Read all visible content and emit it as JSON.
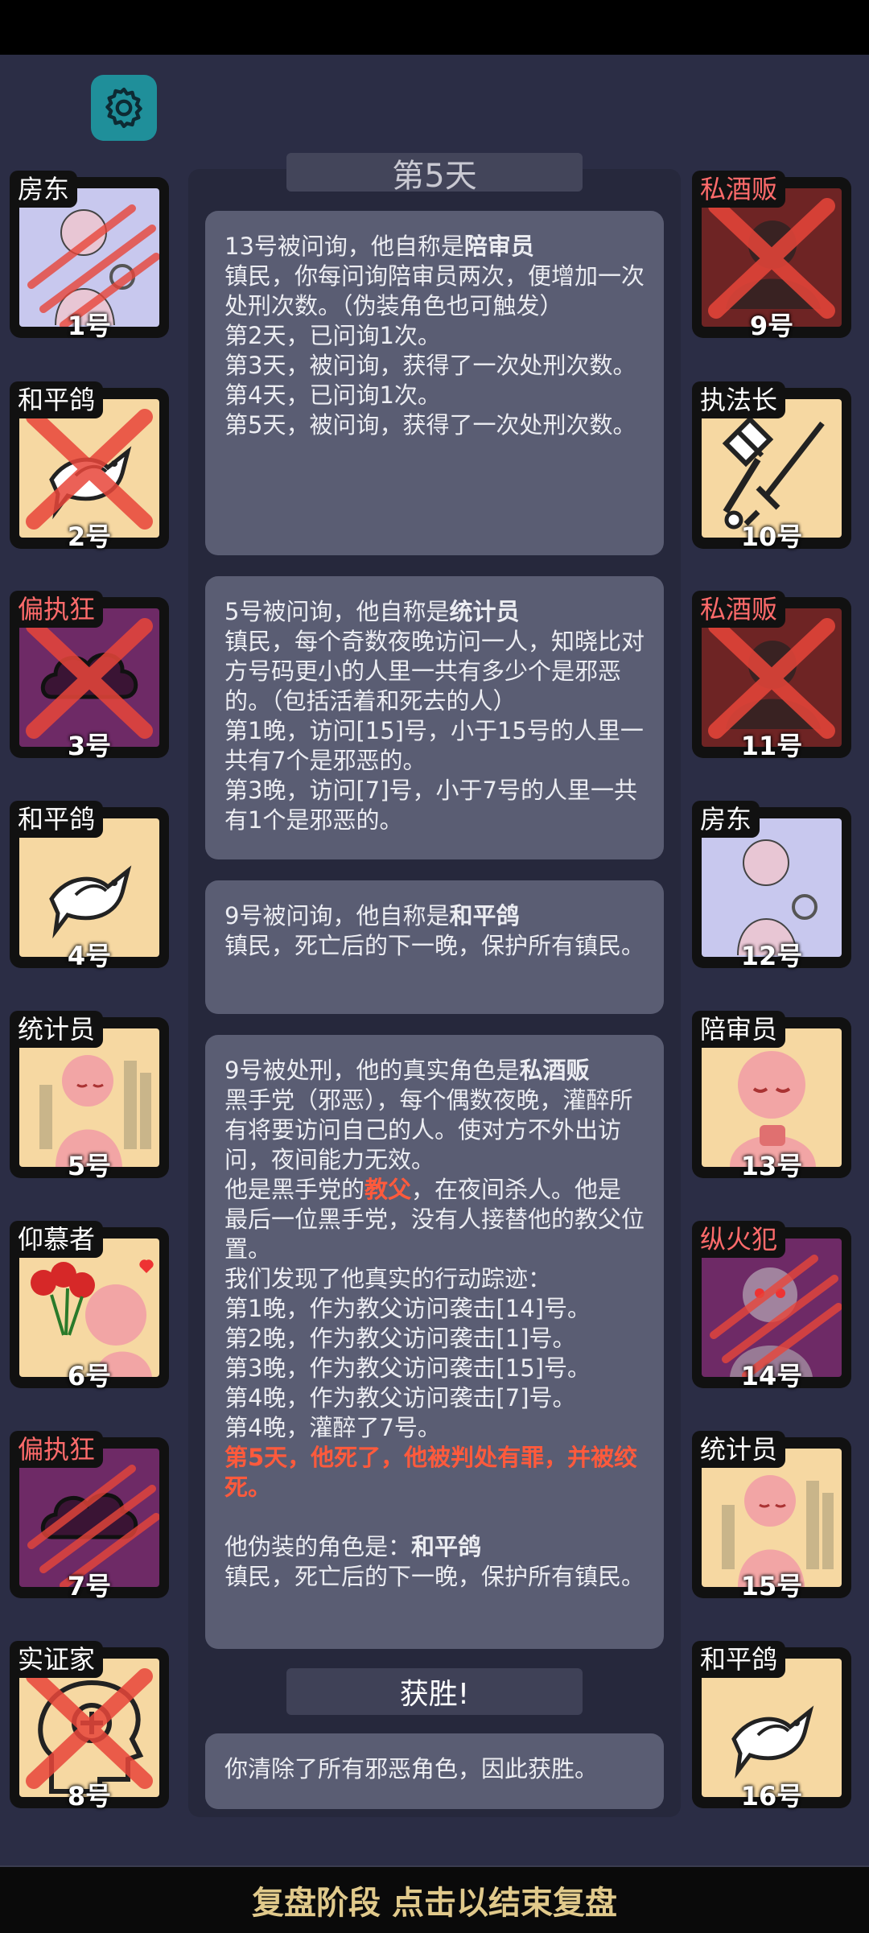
{
  "colors": {
    "bg": "#2b2d45",
    "evil_text": "#ff6b6b",
    "highlight": "#ff5a3c",
    "bottom_text": "#e0c98b"
  },
  "settings": {
    "icon": "gear-icon"
  },
  "day_header": "第5天",
  "messages": [
    {
      "lines": [
        {
          "parts": [
            {
              "t": "13号被问询，他自称是"
            },
            {
              "t": "陪审员",
              "b": true
            }
          ]
        },
        {
          "parts": [
            {
              "t": "镇民，你每问询陪审员两次，便增加一次处刑次数。（伪装角色也可触发）"
            }
          ]
        },
        {
          "parts": [
            {
              "t": "第2天，已问询1次。"
            }
          ]
        },
        {
          "parts": [
            {
              "t": "第3天，被问询，获得了一次处刑次数。"
            }
          ]
        },
        {
          "parts": [
            {
              "t": "第4天，已问询1次。"
            }
          ]
        },
        {
          "parts": [
            {
              "t": "第5天，被问询，获得了一次处刑次数。"
            }
          ]
        }
      ]
    },
    {
      "lines": [
        {
          "parts": [
            {
              "t": "5号被问询，他自称是"
            },
            {
              "t": "统计员",
              "b": true
            }
          ]
        },
        {
          "parts": [
            {
              "t": "镇民，每个奇数夜晚访问一人，知晓比对方号码更小的人里一共有多少个是邪恶的。（包括活着和死去的人）"
            }
          ]
        },
        {
          "parts": [
            {
              "t": "第1晚，访问[15]号，小于15号的人里一共有7个是邪恶的。"
            }
          ]
        },
        {
          "parts": [
            {
              "t": "第3晚，访问[7]号，小于7号的人里一共有1个是邪恶的。"
            }
          ]
        }
      ]
    },
    {
      "lines": [
        {
          "parts": [
            {
              "t": "9号被问询，他自称是"
            },
            {
              "t": "和平鸽",
              "b": true
            }
          ]
        },
        {
          "parts": [
            {
              "t": "镇民，死亡后的下一晚，保护所有镇民。"
            }
          ]
        }
      ]
    },
    {
      "lines": [
        {
          "parts": [
            {
              "t": "9号被处刑，他的真实角色是"
            },
            {
              "t": "私酒贩",
              "b": true
            }
          ]
        },
        {
          "parts": [
            {
              "t": "黑手党（邪恶），每个偶数夜晚，灌醉所有将要访问自己的人。使对方不外出访问，夜间能力无效。"
            }
          ]
        },
        {
          "parts": [
            {
              "t": "他是黑手党的"
            },
            {
              "t": "教父",
              "r": true
            },
            {
              "t": "，在夜间杀人。他是最后一位黑手党，没有人接替他的教父位置。"
            }
          ]
        },
        {
          "parts": [
            {
              "t": "我们发现了他真实的行动踪迹："
            }
          ]
        },
        {
          "parts": [
            {
              "t": "第1晚，作为教父访问袭击[14]号。"
            }
          ]
        },
        {
          "parts": [
            {
              "t": "第2晚，作为教父访问袭击[1]号。"
            }
          ]
        },
        {
          "parts": [
            {
              "t": "第3晚，作为教父访问袭击[15]号。"
            }
          ]
        },
        {
          "parts": [
            {
              "t": "第4晚，作为教父访问袭击[7]号。"
            }
          ]
        },
        {
          "parts": [
            {
              "t": "第4晚，灌醉了7号。"
            }
          ]
        },
        {
          "parts": [
            {
              "t": "第5天，他死了，他被判处有罪，并被绞死。",
              "r": true
            }
          ]
        },
        {
          "parts": [
            {
              "t": " "
            }
          ]
        },
        {
          "parts": [
            {
              "t": "他伪装的角色是："
            },
            {
              "t": "和平鸽",
              "b": true
            }
          ]
        },
        {
          "parts": [
            {
              "t": "镇民，死亡后的下一晚，保护所有镇民。"
            }
          ]
        }
      ]
    }
  ],
  "win_header": "获胜!",
  "win_message": "你清除了所有邪恶角色，因此获胜。",
  "bottom_bar": "复盘阶段 点击以结束复盘",
  "players_left": [
    {
      "num": "1号",
      "role": "房东",
      "evil": false,
      "art": "landlord",
      "bg": "#c8c8ee",
      "state": "claw"
    },
    {
      "num": "2号",
      "role": "和平鸽",
      "evil": false,
      "art": "dove",
      "bg": "#f6d8a2",
      "state": "x"
    },
    {
      "num": "3号",
      "role": "偏执狂",
      "evil": true,
      "art": "cloud",
      "bg": "#6e2a66",
      "state": "x"
    },
    {
      "num": "4号",
      "role": "和平鸽",
      "evil": false,
      "art": "dove",
      "bg": "#f6d8a2",
      "state": "alive"
    },
    {
      "num": "5号",
      "role": "统计员",
      "evil": false,
      "art": "stats",
      "bg": "#f6d8a2",
      "state": "alive"
    },
    {
      "num": "6号",
      "role": "仰慕者",
      "evil": false,
      "art": "admirer",
      "bg": "#f6d8a2",
      "state": "alive"
    },
    {
      "num": "7号",
      "role": "偏执狂",
      "evil": true,
      "art": "cloud",
      "bg": "#6e2a66",
      "state": "claw"
    },
    {
      "num": "8号",
      "role": "实证家",
      "evil": false,
      "art": "head",
      "bg": "#f6d8a2",
      "state": "x"
    }
  ],
  "players_right": [
    {
      "num": "9号",
      "role": "私酒贩",
      "evil": true,
      "art": "bootleg",
      "bg": "#6e2424",
      "state": "x"
    },
    {
      "num": "10号",
      "role": "执法长",
      "evil": false,
      "art": "hammer",
      "bg": "#f6d8a2",
      "state": "alive"
    },
    {
      "num": "11号",
      "role": "私酒贩",
      "evil": true,
      "art": "bootleg",
      "bg": "#6e2424",
      "state": "x"
    },
    {
      "num": "12号",
      "role": "房东",
      "evil": false,
      "art": "landlord",
      "bg": "#c8c8ee",
      "state": "alive"
    },
    {
      "num": "13号",
      "role": "陪审员",
      "evil": false,
      "art": "juror",
      "bg": "#f6d8a2",
      "state": "alive"
    },
    {
      "num": "14号",
      "role": "纵火犯",
      "evil": true,
      "art": "arson",
      "bg": "#6e2a66",
      "state": "claw"
    },
    {
      "num": "15号",
      "role": "统计员",
      "evil": false,
      "art": "stats",
      "bg": "#f6d8a2",
      "state": "alive"
    },
    {
      "num": "16号",
      "role": "和平鸽",
      "evil": false,
      "art": "dove",
      "bg": "#f6d8a2",
      "state": "alive"
    }
  ]
}
